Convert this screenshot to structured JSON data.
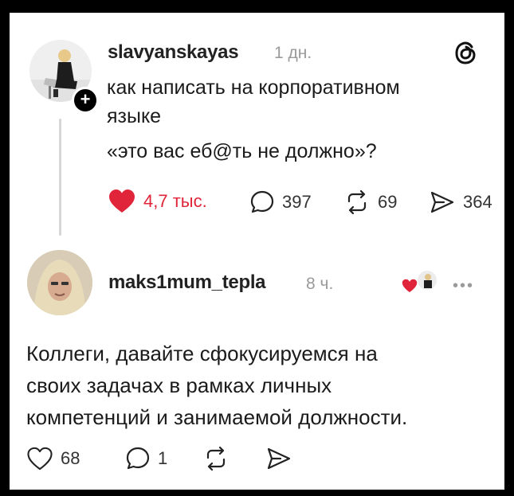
{
  "post": {
    "username": "slavyanskayas",
    "time": "1 дн.",
    "lines": [
      "как написать на корпоративном",
      "языке",
      "«это вас еб@ть не должно»?"
    ],
    "likes": "4,7 тыс.",
    "comments": "397",
    "reposts": "69",
    "shares": "364",
    "avatar_icon": "user-avatar-photo",
    "follow_icon": "plus-icon"
  },
  "reply": {
    "username": "maks1mum_tepla",
    "time": "8 ч.",
    "lines": [
      "Коллеги, давайте сфокусируемся на",
      "своих задачах в рамках личных",
      "компетенций и занимаемой должности."
    ],
    "likes": "68",
    "comments": "1"
  },
  "colors": {
    "like_red": "#e0243a",
    "text": "#1b1b1b",
    "muted": "#9a9a9a"
  }
}
